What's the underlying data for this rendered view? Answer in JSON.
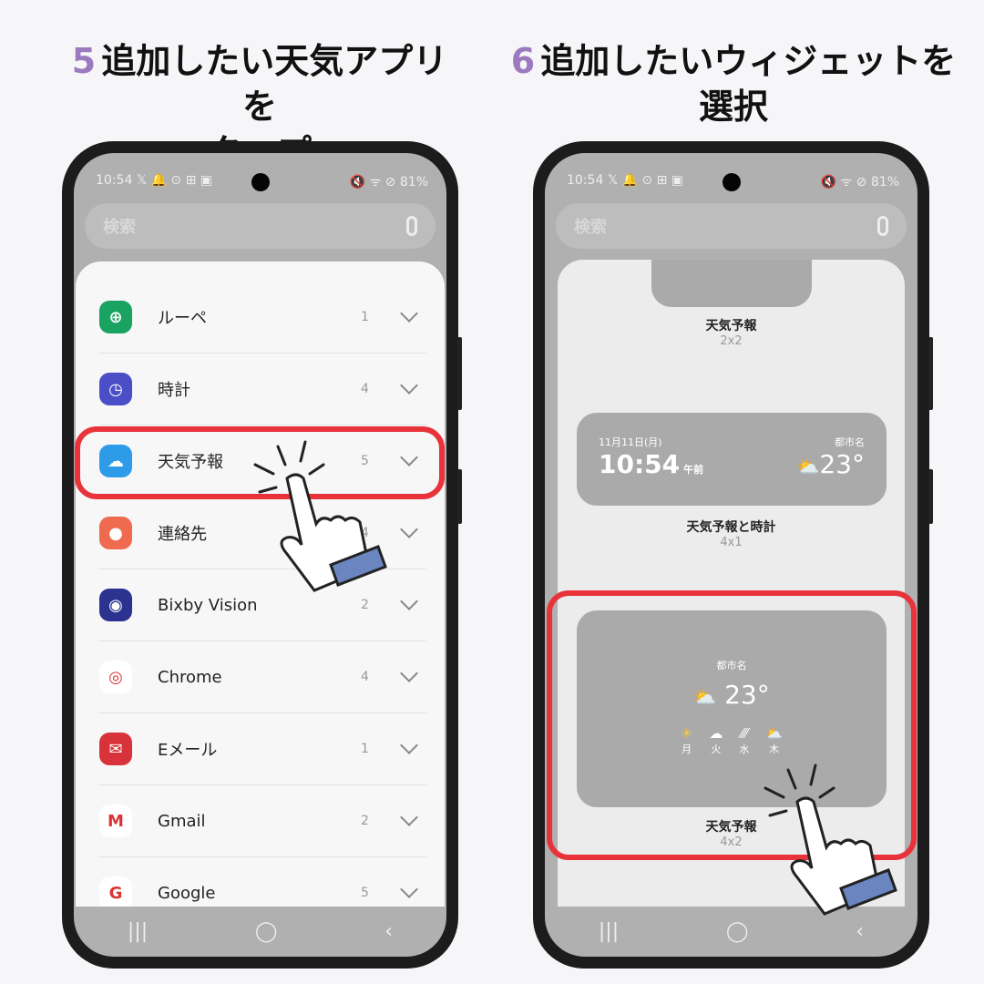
{
  "steps": [
    {
      "num": "5",
      "line1": "追加したい天気アプリを",
      "line2": "タップ"
    },
    {
      "num": "6",
      "line1": "追加したいウィジェットを",
      "line2": "選択"
    }
  ],
  "status": {
    "time": "10:54",
    "icons_left": "𝕏 🔔 ⊙ ⊞ ▣",
    "icons_right": "🔇 ᯤ ⊘",
    "battery": "81%"
  },
  "search": {
    "placeholder": "検索"
  },
  "apps": [
    {
      "label": "ルーペ",
      "count": "1",
      "icon": "magnifier-plus-icon",
      "color": "#1aa260",
      "glyph": "⊕"
    },
    {
      "label": "時計",
      "count": "4",
      "icon": "clock-icon",
      "color": "#4a4fc8",
      "glyph": "◷"
    },
    {
      "label": "天気予報",
      "count": "5",
      "icon": "weather-icon",
      "color": "#2e9be8",
      "glyph": "☁"
    },
    {
      "label": "連絡先",
      "count": "4",
      "icon": "contacts-icon",
      "color": "#ef6a4f",
      "glyph": "●"
    },
    {
      "label": "Bixby Vision",
      "count": "2",
      "icon": "eye-icon",
      "color": "#2b3290",
      "glyph": "◉"
    },
    {
      "label": "Chrome",
      "count": "4",
      "icon": "chrome-icon",
      "color": "#ffffff",
      "glyph": "◎"
    },
    {
      "label": "Eメール",
      "count": "1",
      "icon": "mail-icon",
      "color": "#d8323a",
      "glyph": "✉"
    },
    {
      "label": "Gmail",
      "count": "2",
      "icon": "gmail-icon",
      "color": "#ffffff",
      "glyph": "M"
    },
    {
      "label": "Google",
      "count": "5",
      "icon": "google-icon",
      "color": "#ffffff",
      "glyph": "G"
    }
  ],
  "widgets": [
    {
      "name": "天気予報",
      "size": "2x2"
    },
    {
      "name": "天気予報と時計",
      "size": "4x1",
      "date": "11月11日(月)",
      "time": "10:54",
      "ampm": "午前",
      "city": "都市名",
      "temp": "23°"
    },
    {
      "name": "天気予報",
      "size": "4x2",
      "city": "都市名",
      "temp": "23°",
      "days": [
        "月",
        "火",
        "水",
        "木"
      ],
      "day_icons": [
        "☀",
        "☁",
        "⁄⁄⁄",
        "⛅"
      ]
    }
  ],
  "nav": {
    "recent": "|||",
    "home": "◯",
    "back": "‹"
  },
  "colors": {
    "highlight": "#e8333a",
    "step_number": "#9b7ac0"
  }
}
